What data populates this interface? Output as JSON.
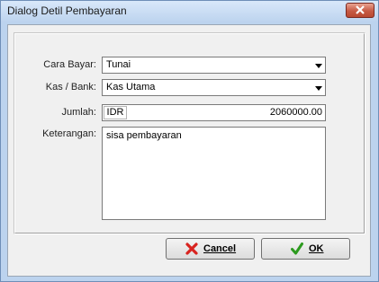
{
  "window": {
    "title": "Dialog Detil Pembayaran",
    "close_label": "x"
  },
  "form": {
    "cara_bayar_label": "Cara Bayar:",
    "cara_bayar_value": "Tunai",
    "kas_bank_label": "Kas / Bank:",
    "kas_bank_value": "Kas Utama",
    "jumlah_label": "Jumlah:",
    "currency": "IDR",
    "jumlah_value": "2060000.00",
    "keterangan_label": "Keterangan:",
    "keterangan_value": "sisa pembayaran"
  },
  "buttons": {
    "cancel_label": "Cancel",
    "ok_label": "OK"
  },
  "icons": {
    "cancel": "red-x-icon",
    "ok": "green-check-icon",
    "dropdown": "chevron-down-icon"
  },
  "colors": {
    "title_bg": "#bcd3ee",
    "client_bg": "#f0f0f0",
    "close_bg": "#c75a44"
  }
}
